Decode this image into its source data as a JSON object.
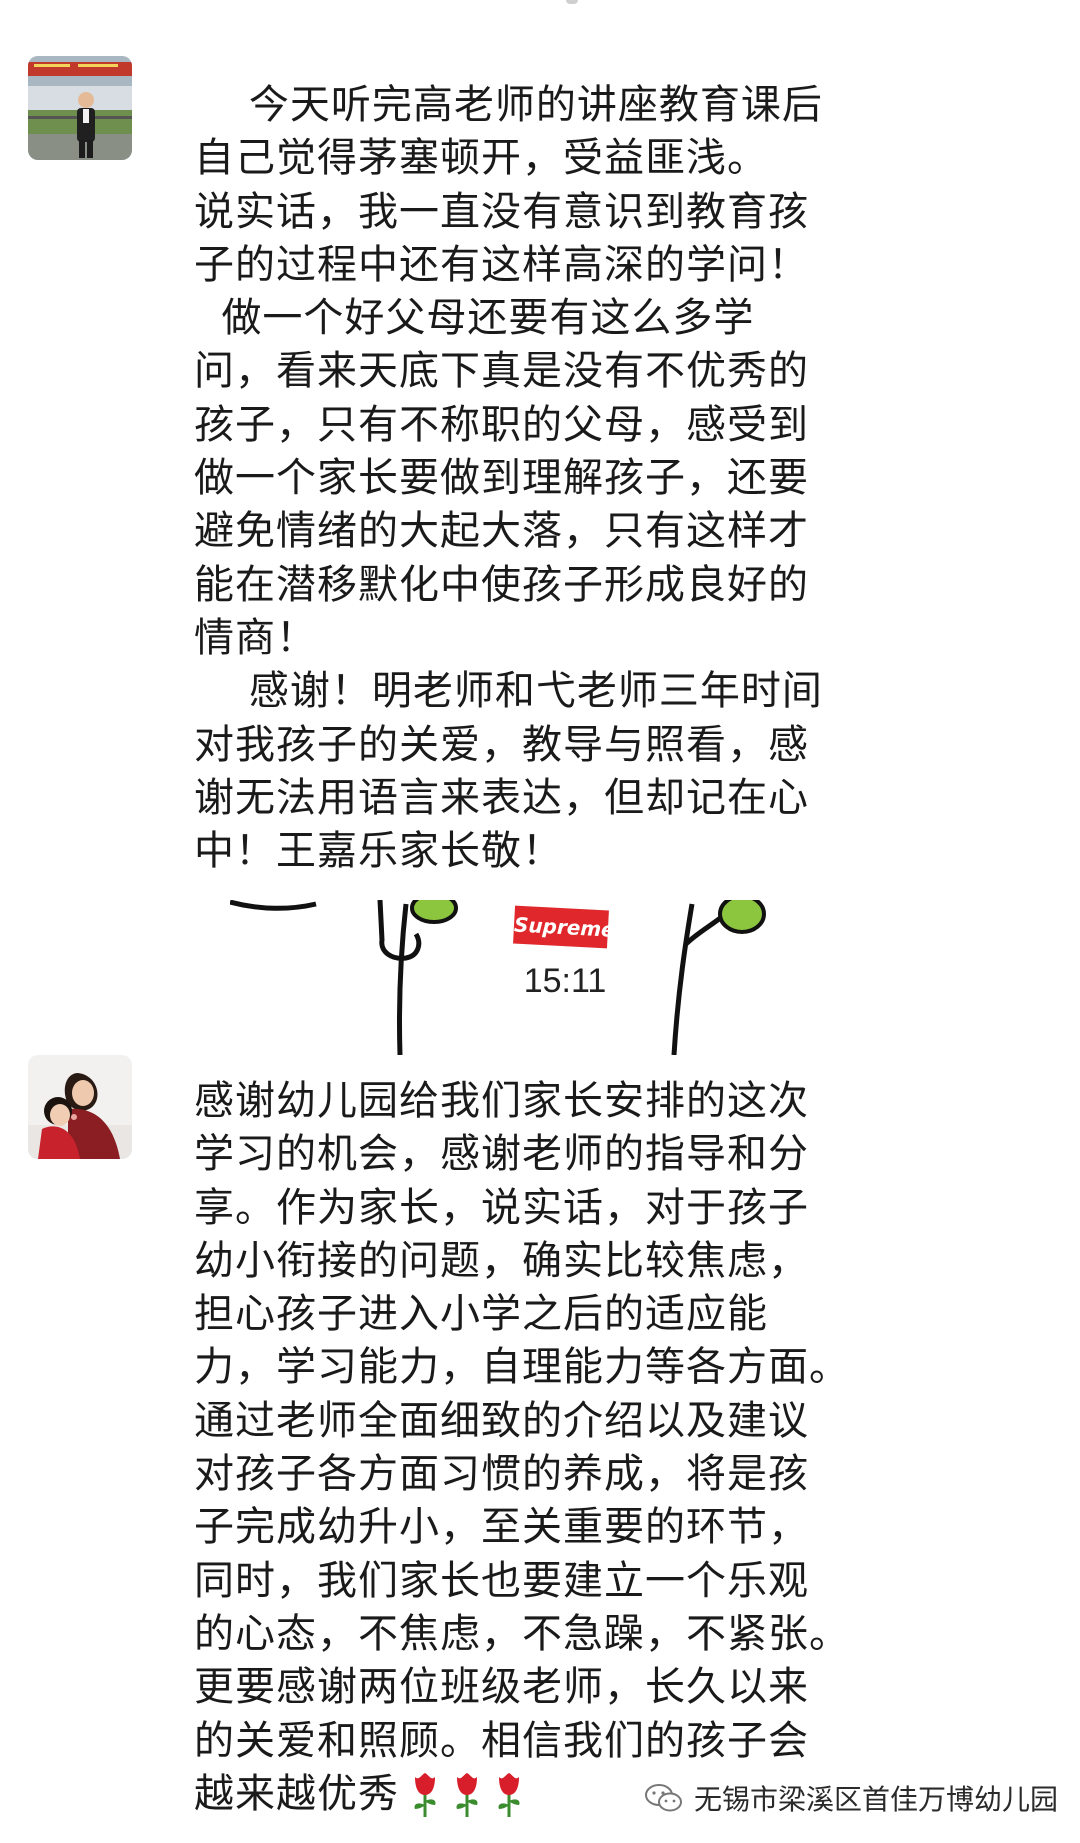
{
  "messages": [
    {
      "avatar_icon": "man-portrait-avatar",
      "text": "    今天听完高老师的讲座教育课后\n自己觉得茅塞顿开，受益匪浅。\n说实话，我一直没有意识到教育孩\n子的过程中还有这样高深的学问！\n  做一个好父母还要有这么多学\n问，看来天底下真是没有不优秀的\n孩子，只有不称职的父母，感受到\n做一个家长要做到理解孩子，还要\n避免情绪的大起大落，只有这样才\n能在潜移默化中使孩子形成良好的\n情商！\n    感谢！明老师和弋老师三年时间\n对我孩子的关爱，教导与照看，感\n谢无法用语言来表达，但却记在心\n中！王嘉乐家长敬！"
    },
    {
      "avatar_icon": "mother-child-avatar",
      "text": "感谢幼儿园给我们家长安排的这次\n学习的机会，感谢老师的指导和分\n享。作为家长，说实话，对于孩子\n幼小衔接的问题，确实比较焦虑，\n担心孩子进入小学之后的适应能\n力，学习能力，自理能力等各方面。\n通过老师全面细致的介绍以及建议\n对孩子各方面习惯的养成，将是孩\n子完成幼升小，至关重要的环节，\n同时，我们家长也要建立一个乐观\n的心态，不焦虑，不急躁，不紧张。\n更要感谢两位班级老师，长久以来\n的关爱和照顾。相信我们的孩子会\n越来越优秀",
      "emoji": "rose-icon x3"
    }
  ],
  "sticker": {
    "badge": "Supreme",
    "time": "15:11"
  },
  "watermark": {
    "text": "无锡市梁溪区首佳万博幼儿园",
    "icon": "wechat-icon"
  },
  "colors": {
    "badge_red": "#e0282c",
    "sticker_green": "#8cc63f",
    "rose_red": "#d81e2a"
  }
}
